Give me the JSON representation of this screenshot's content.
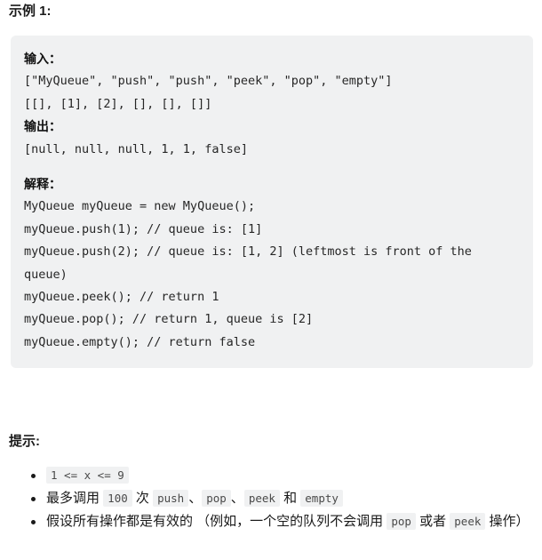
{
  "example": {
    "heading": "示例 1:",
    "lines": [
      {
        "type": "label",
        "text": "输入："
      },
      {
        "type": "code",
        "text": "[\"MyQueue\", \"push\", \"push\", \"peek\", \"pop\", \"empty\"]"
      },
      {
        "type": "code",
        "text": "[[], [1], [2], [], [], []]"
      },
      {
        "type": "label",
        "text": "输出："
      },
      {
        "type": "code",
        "text": "[null, null, null, 1, 1, false]"
      },
      {
        "type": "blank",
        "text": ""
      },
      {
        "type": "label",
        "text": "解释："
      },
      {
        "type": "code",
        "text": "MyQueue myQueue = new MyQueue();"
      },
      {
        "type": "code",
        "text": "myQueue.push(1); // queue is: [1]"
      },
      {
        "type": "code",
        "text": "myQueue.push(2); // queue is: [1, 2] (leftmost is front of the queue)"
      },
      {
        "type": "code",
        "text": "myQueue.peek(); // return 1"
      },
      {
        "type": "code",
        "text": "myQueue.pop(); // return 1, queue is [2]"
      },
      {
        "type": "code",
        "text": "myQueue.empty(); // return false"
      }
    ]
  },
  "hints": {
    "heading": "提示:",
    "items": [
      {
        "parts": [
          {
            "kind": "code",
            "text": "1 <= x <= 9"
          }
        ]
      },
      {
        "parts": [
          {
            "kind": "text",
            "text": "最多调用 "
          },
          {
            "kind": "code",
            "text": "100"
          },
          {
            "kind": "text",
            "text": " 次 "
          },
          {
            "kind": "code",
            "text": "push"
          },
          {
            "kind": "text",
            "text": "、"
          },
          {
            "kind": "code",
            "text": "pop"
          },
          {
            "kind": "text",
            "text": "、"
          },
          {
            "kind": "code",
            "text": "peek"
          },
          {
            "kind": "text",
            "text": " 和 "
          },
          {
            "kind": "code",
            "text": "empty"
          }
        ]
      },
      {
        "parts": [
          {
            "kind": "text",
            "text": "假设所有操作都是有效的 （例如，一个空的队列不会调用 "
          },
          {
            "kind": "code",
            "text": "pop"
          },
          {
            "kind": "text",
            "text": " 或者 "
          },
          {
            "kind": "code",
            "text": "peek"
          },
          {
            "kind": "text",
            "text": " 操作）"
          }
        ]
      }
    ]
  },
  "colors": {
    "code_block_bg": "#f0f1f2",
    "chip_bg": "#f0f1f2",
    "text": "#1a1a1a",
    "code_text": "#262626",
    "chip_text": "#4a4a4a",
    "page_bg": "#ffffff"
  }
}
